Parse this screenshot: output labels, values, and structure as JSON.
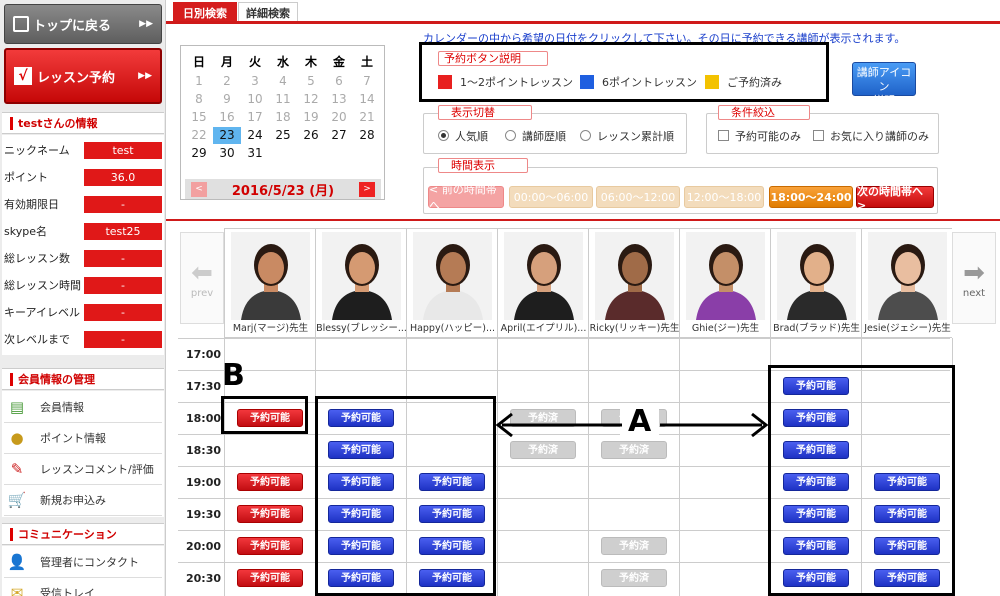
{
  "tabs": {
    "daily": "日別検索",
    "detail": "詳細検索"
  },
  "sidebar": {
    "top_button": "トップに戻る",
    "lesson_button": "レッスン予約",
    "user_section_title": "testさんの情報",
    "user_info": [
      {
        "label": "ニックネーム",
        "value": "test"
      },
      {
        "label": "ポイント",
        "value": "36.0"
      },
      {
        "label": "有効期限日",
        "value": "-"
      },
      {
        "label": "skype名",
        "value": "test25"
      },
      {
        "label": "総レッスン数",
        "value": "-"
      },
      {
        "label": "総レッスン時間",
        "value": "-"
      },
      {
        "label": "キーアイレベル",
        "value": "-"
      },
      {
        "label": "次レベルまで",
        "value": "-"
      }
    ],
    "member_section_title": "会員情報の管理",
    "member_menu": [
      "会員情報",
      "ポイント情報",
      "レッスンコメント/評価",
      "新規お申込み"
    ],
    "comm_section_title": "コミュニケーション",
    "comm_menu": [
      "管理者にコンタクト",
      "受信トレイ"
    ]
  },
  "instruction": "カレンダーの中から希望の日付をクリックして下さい。その日に予約できる講師が表示されます。",
  "calendar": {
    "weekdays": [
      "日",
      "月",
      "火",
      "水",
      "木",
      "金",
      "土"
    ],
    "weeks": [
      [
        "1",
        "2",
        "3",
        "4",
        "5",
        "6",
        "7"
      ],
      [
        "8",
        "9",
        "10",
        "11",
        "12",
        "13",
        "14"
      ],
      [
        "15",
        "16",
        "17",
        "18",
        "19",
        "20",
        "21"
      ],
      [
        "22",
        "23",
        "24",
        "25",
        "26",
        "27",
        "28"
      ],
      [
        "29",
        "30",
        "31",
        "",
        "",
        "",
        ""
      ]
    ],
    "selected": "23",
    "current_date": "2016/5/23 (月)",
    "prev": "<",
    "next": ">"
  },
  "legend": {
    "title": "予約ボタン説明",
    "items": [
      {
        "label": "1～2ポイントレッスン",
        "color": "#e8201f"
      },
      {
        "label": "6ポイントレッスン",
        "color": "#1f5fe0"
      },
      {
        "label": "ご予約済み",
        "color": "#f3c200"
      }
    ]
  },
  "icon_button": {
    "line1": "講師アイコン",
    "line2": "説明"
  },
  "display_toggle": {
    "title": "表示切替",
    "options": [
      "人気順",
      "講師歴順",
      "レッスン累計順"
    ],
    "selected": 0
  },
  "filter": {
    "title": "条件絞込",
    "options": [
      "予約可能のみ",
      "お気に入り講師のみ"
    ]
  },
  "time_display": {
    "title": "時間表示",
    "buttons": [
      "< 前の時間帯へ",
      "00:00～06:00",
      "06:00～12:00",
      "12:00～18:00",
      "18:00～24:00",
      "次の時間帯へ >"
    ],
    "active": "18:00～24:00"
  },
  "nav": {
    "prev": "prev",
    "next": "next"
  },
  "teachers": [
    "Marj(マージ)先生",
    "Blessy(ブレッシー...",
    "Happy(ハッピー)...",
    "April(エイプリル)...",
    "Ricky(リッキー)先生",
    "Ghie(ジー)先生",
    "Brad(ブラッド)先生",
    "Jesie(ジェシー)先生"
  ],
  "times": [
    "17:00",
    "17:30",
    "18:00",
    "18:30",
    "19:00",
    "19:30",
    "20:00",
    "20:30"
  ],
  "slot_labels": {
    "available": "予約可能",
    "booked": "予約済"
  },
  "schedule": [
    [
      "",
      "",
      "",
      "",
      "",
      "",
      "",
      ""
    ],
    [
      "",
      "",
      "",
      "",
      "",
      "",
      "blue",
      ""
    ],
    [
      "red",
      "blue",
      "",
      "gray",
      "gray",
      "",
      "blue",
      ""
    ],
    [
      "",
      "blue",
      "",
      "gray",
      "gray",
      "",
      "blue",
      ""
    ],
    [
      "red",
      "blue",
      "blue",
      "",
      "",
      "",
      "blue",
      "blue"
    ],
    [
      "red",
      "blue",
      "blue",
      "",
      "",
      "",
      "blue",
      "blue"
    ],
    [
      "red",
      "blue",
      "blue",
      "",
      "gray",
      "",
      "blue",
      "blue"
    ],
    [
      "red",
      "blue",
      "blue",
      "",
      "gray",
      "",
      "blue",
      "blue"
    ]
  ],
  "annotations": {
    "a": "A",
    "b": "B"
  }
}
